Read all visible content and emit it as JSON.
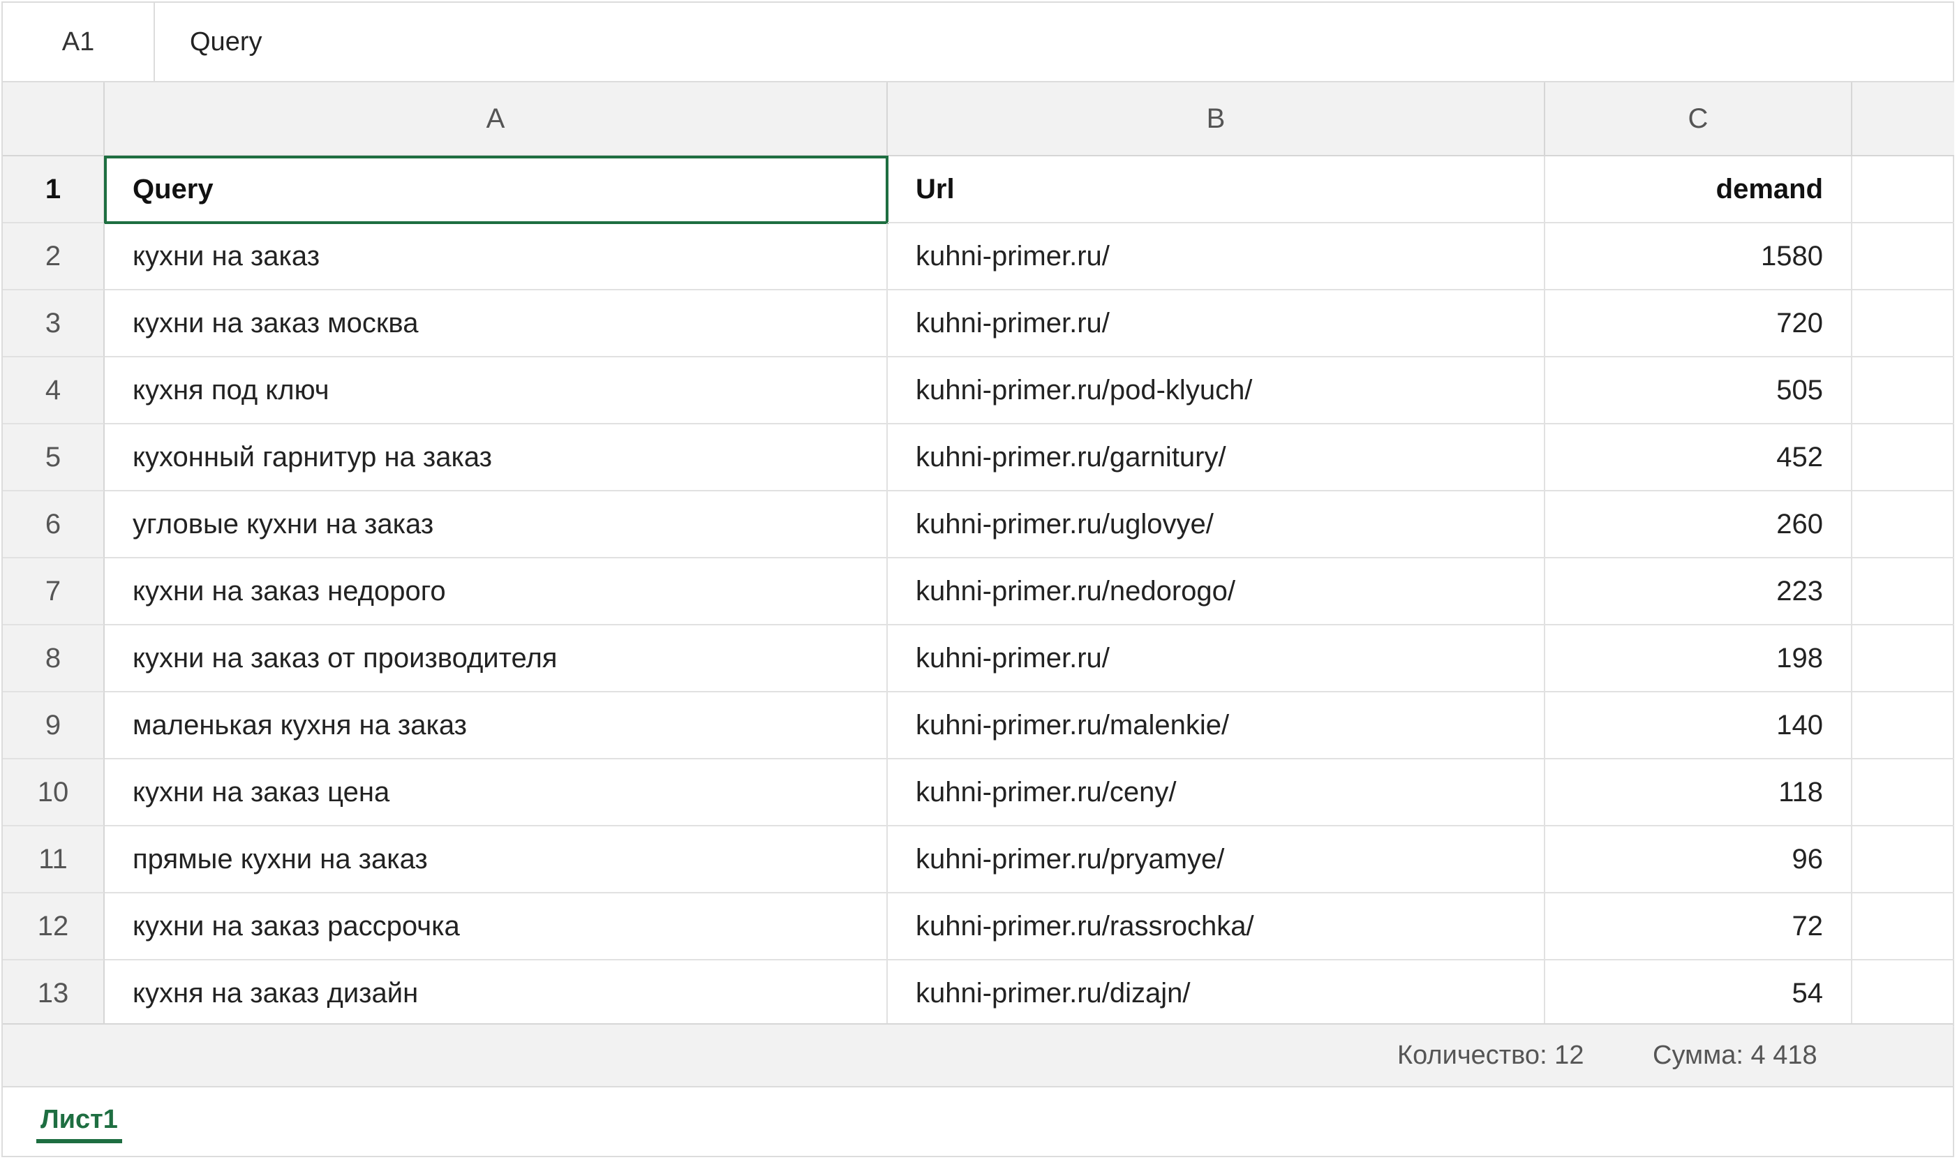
{
  "formula_bar": {
    "cell_ref": "A1",
    "value": "Query"
  },
  "columns": [
    "A",
    "B",
    "C"
  ],
  "header": {
    "row_number": "1",
    "query": "Query",
    "url": "Url",
    "demand": "demand"
  },
  "rows": [
    {
      "n": "2",
      "query": "кухни на заказ",
      "url": "kuhni-primer.ru/",
      "demand": "1580"
    },
    {
      "n": "3",
      "query": "кухни на заказ москва",
      "url": "kuhni-primer.ru/",
      "demand": "720"
    },
    {
      "n": "4",
      "query": "кухня под ключ",
      "url": "kuhni-primer.ru/pod-klyuch/",
      "demand": "505"
    },
    {
      "n": "5",
      "query": "кухонный гарнитур на заказ",
      "url": "kuhni-primer.ru/garnitury/",
      "demand": "452"
    },
    {
      "n": "6",
      "query": "угловые кухни на заказ",
      "url": "kuhni-primer.ru/uglovye/",
      "demand": "260"
    },
    {
      "n": "7",
      "query": "кухни на заказ недорого",
      "url": "kuhni-primer.ru/nedorogo/",
      "demand": "223"
    },
    {
      "n": "8",
      "query": "кухни на заказ от производителя",
      "url": "kuhni-primer.ru/",
      "demand": "198"
    },
    {
      "n": "9",
      "query": "маленькая кухня на заказ",
      "url": "kuhni-primer.ru/malenkie/",
      "demand": "140"
    },
    {
      "n": "10",
      "query": "кухни на заказ цена",
      "url": "kuhni-primer.ru/ceny/",
      "demand": "118"
    },
    {
      "n": "11",
      "query": "прямые кухни на заказ",
      "url": "kuhni-primer.ru/pryamye/",
      "demand": "96"
    },
    {
      "n": "12",
      "query": "кухни на заказ рассрочка",
      "url": "kuhni-primer.ru/rassrochka/",
      "demand": "72"
    },
    {
      "n": "13",
      "query": "кухня на заказ дизайн",
      "url": "kuhni-primer.ru/dizajn/",
      "demand": "54"
    }
  ],
  "status": {
    "count": "Количество: 12",
    "sum": "Сумма: 4 418"
  },
  "sheet_tabs": [
    {
      "label": "Лист1",
      "active": true
    }
  ],
  "colors": {
    "accent": "#1e6e41",
    "header_bg": "#f2f2f2",
    "grid_line": "#e1e1e1"
  }
}
